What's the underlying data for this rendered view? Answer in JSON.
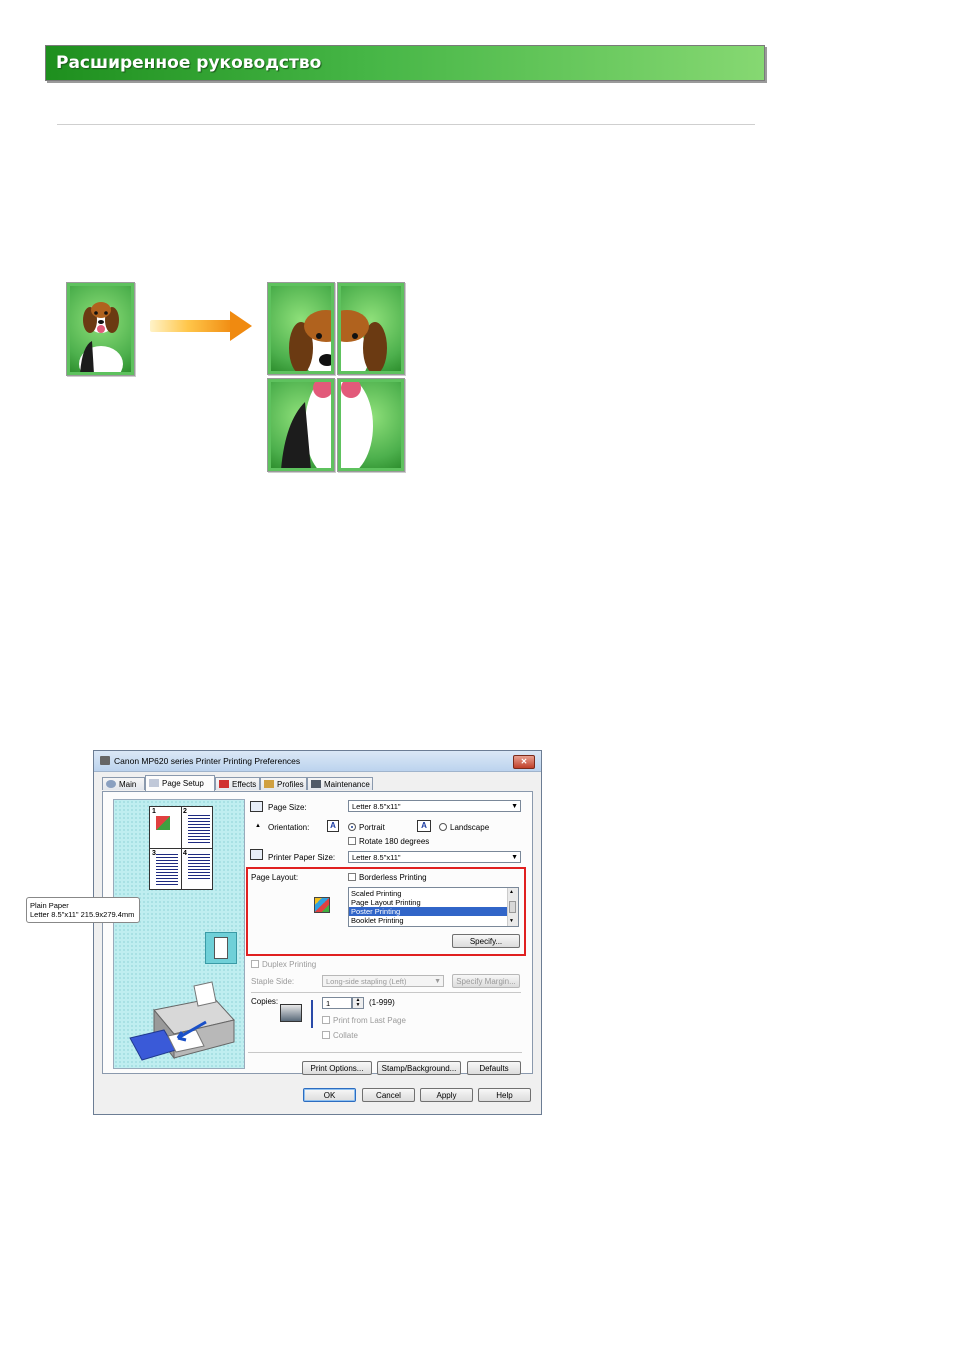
{
  "header": {
    "title": "Расширенное руководство"
  },
  "dialog": {
    "title": "Canon MP620 series Printer Printing Preferences",
    "close_label": "✕",
    "tabs": [
      {
        "label": "Main",
        "icon": "main-icon"
      },
      {
        "label": "Page Setup",
        "icon": "page-setup-icon"
      },
      {
        "label": "Effects",
        "icon": "effects-icon"
      },
      {
        "label": "Profiles",
        "icon": "profiles-icon"
      },
      {
        "label": "Maintenance",
        "icon": "maintenance-icon"
      }
    ],
    "active_tab": "Page Setup",
    "preview": {
      "numbers": [
        "1",
        "2",
        "3",
        "4"
      ],
      "paper_type": "Plain Paper",
      "paper_size": "Letter 8.5\"x11\" 215.9x279.4mm"
    },
    "page_size": {
      "label": "Page Size:",
      "value": "Letter 8.5\"x11\""
    },
    "orientation": {
      "label": "Orientation:",
      "portrait": "Portrait",
      "landscape": "Landscape",
      "selected": "Portrait",
      "icon_letter": "A"
    },
    "rotate": {
      "label": "Rotate 180 degrees",
      "checked": false
    },
    "printer_paper_size": {
      "label": "Printer Paper Size:",
      "value": "Letter 8.5\"x11\""
    },
    "page_layout": {
      "label": "Page Layout:",
      "borderless": "Borderless Printing",
      "options": [
        "Scaled Printing",
        "Page Layout Printing",
        "Poster Printing",
        "Booklet Printing"
      ],
      "selected": "Poster Printing",
      "specify_label": "Specify..."
    },
    "duplex": {
      "label": "Duplex Printing",
      "checked": false
    },
    "staple_side": {
      "label": "Staple Side:",
      "value": "Long-side stapling (Left)",
      "margin_label": "Specify Margin..."
    },
    "copies": {
      "label": "Copies:",
      "value": "1",
      "range": "(1-999)",
      "print_from_last": "Print from Last Page",
      "collate": "Collate"
    },
    "bottom_buttons": [
      "Print Options...",
      "Stamp/Background...",
      "Defaults"
    ],
    "dialog_buttons": [
      "OK",
      "Cancel",
      "Apply",
      "Help"
    ]
  },
  "colors": {
    "banner_dark": "#1e8f1e",
    "banner_light": "#86d872",
    "highlight_box": "#e02020",
    "list_selection": "#3165c8",
    "preview_bg": "#bfeef0"
  }
}
